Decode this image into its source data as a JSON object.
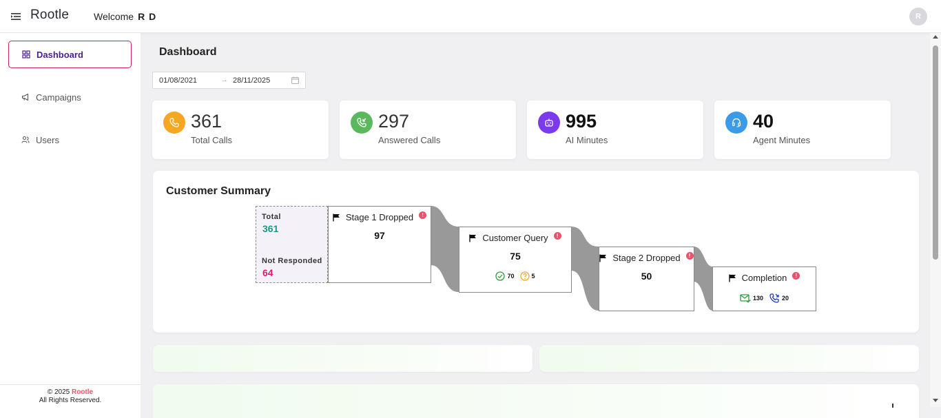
{
  "header": {
    "logo": "Rootle",
    "welcome_label": "Welcome",
    "user_name": "R D",
    "avatar_initial": "R"
  },
  "sidebar": {
    "items": [
      {
        "label": "Dashboard",
        "icon": "grid-icon",
        "active": true
      },
      {
        "label": "Campaigns",
        "icon": "megaphone-icon",
        "active": false
      },
      {
        "label": "Users",
        "icon": "users-icon",
        "active": false
      }
    ],
    "footer_copyright": "© 2025",
    "footer_brand": "Rootle",
    "footer_rights": "All Rights Reserved."
  },
  "main": {
    "title": "Dashboard",
    "date_range": {
      "start": "01/08/2021",
      "separator": "→",
      "end": "28/11/2025"
    },
    "stats": [
      {
        "value": "361",
        "label": "Total Calls",
        "icon": "phone-icon",
        "color": "#f5a623"
      },
      {
        "value": "297",
        "label": "Answered Calls",
        "icon": "phone-incoming-icon",
        "color": "#5cb85c"
      },
      {
        "value": "995",
        "label": "AI Minutes",
        "icon": "robot-icon",
        "color": "#7c3aed"
      },
      {
        "value": "40",
        "label": "Agent Minutes",
        "icon": "headset-icon",
        "color": "#3b9be8"
      }
    ],
    "summary": {
      "title": "Customer Summary",
      "total_label": "Total",
      "total_value": "361",
      "not_responded_label": "Not Responded",
      "not_responded_value": "64",
      "stages": [
        {
          "title": "Stage 1 Dropped",
          "value": "97"
        },
        {
          "title": "Customer Query",
          "value": "75",
          "subs": [
            {
              "icon": "check-circle-icon",
              "value": "70",
              "color": "#2e9d3c"
            },
            {
              "icon": "question-circle-icon",
              "value": "5",
              "color": "#f5a623"
            }
          ]
        },
        {
          "title": "Stage 2 Dropped",
          "value": "50"
        },
        {
          "title": "Completion",
          "subs": [
            {
              "icon": "mail-check-icon",
              "value": "130",
              "color": "#2e9d3c"
            },
            {
              "icon": "phone-callback-icon",
              "value": "20",
              "color": "#1f3fbf"
            }
          ]
        }
      ]
    }
  }
}
